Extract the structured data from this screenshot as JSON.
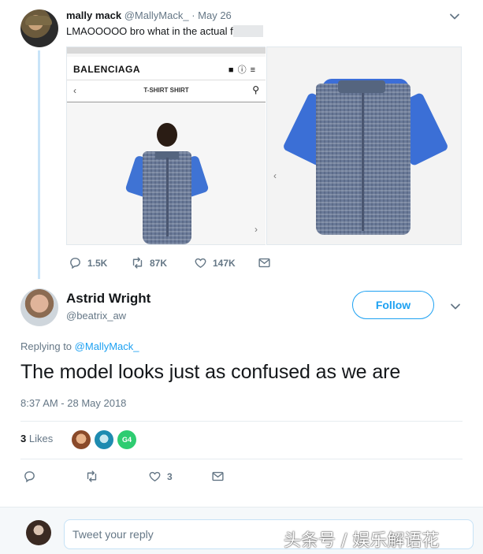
{
  "parent_tweet": {
    "display_name": "mally mack",
    "handle": "@MallyMack_",
    "separator": "·",
    "date": "May 26",
    "text": "LMAOOOOO bro what in the actual f",
    "media_left": {
      "brand": "BALENCIAGA",
      "product_title": "T-SHIRT SHIRT",
      "back_glyph": "‹",
      "next_glyph": "›"
    },
    "media_right": {
      "prev_glyph": "‹"
    },
    "actions": {
      "replies": "1.5K",
      "retweets": "87K",
      "likes": "147K"
    },
    "icons": [
      "avatar",
      "chevron-down-icon",
      "reply-icon",
      "retweet-icon",
      "heart-icon",
      "message-icon",
      "bag-icon",
      "help-icon",
      "menu-icon",
      "search-icon"
    ]
  },
  "main_tweet": {
    "display_name": "Astrid Wright",
    "handle": "@beatrix_aw",
    "follow_label": "Follow",
    "replying_prefix": "Replying to",
    "replying_to": "@MallyMack_",
    "text": "The model looks just as confused as we are",
    "timestamp": "8:37 AM - 28 May 2018",
    "likes_count": "3",
    "likes_label": "Likes",
    "liker_badge": "G4",
    "actions": {
      "likes": "3"
    }
  },
  "reply_box": {
    "placeholder": "Tweet your reply"
  },
  "watermark": "头条号 / 娱乐解语花",
  "colors": {
    "accent": "#1da1f2",
    "muted": "#657786",
    "text": "#14171a",
    "thread_line": "#c9e4f8"
  }
}
